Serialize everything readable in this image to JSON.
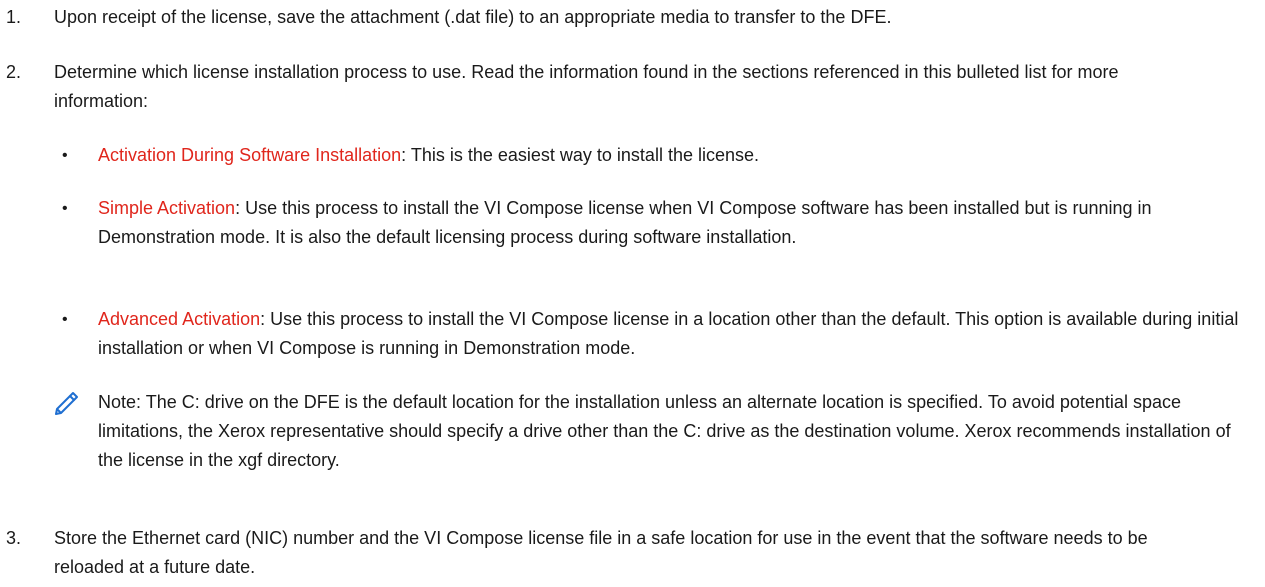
{
  "steps": [
    {
      "num": "1.",
      "text": "Upon receipt of the license, save the attachment (.dat file) to an appropriate media to transfer to the DFE."
    },
    {
      "num": "2.",
      "text": "Determine which license installation process to use. Read the information found in the sections referenced in this bulleted list for more information:"
    },
    {
      "num": "3.",
      "text": "Store the Ethernet card (NIC) number and the VI Compose license file in a safe location for use in the event that the software needs to be reloaded at a future date."
    }
  ],
  "bullets": [
    {
      "link": "Activation During Software Installation",
      "text": ": This is the easiest way to install the license."
    },
    {
      "link": "Simple Activation",
      "text": ": Use this process to install the VI Compose license when VI Compose software has been installed but is running in Demonstration mode. It is also the default licensing process during software installation."
    },
    {
      "link": "Advanced Activation",
      "text": ": Use this process to install the VI Compose license in a location other than the default. This option is available during initial installation or when VI Compose is running in Demonstration mode."
    }
  ],
  "note": {
    "icon": "pencil-icon",
    "text": "Note: The C: drive on the DFE is the default location for the installation unless an alternate location is specified. To avoid potential space limitations, the Xerox representative should specify a drive other than the C: drive as the destination volume. Xerox recommends installation of the license in the xgf directory."
  },
  "colors": {
    "link": "#e0261c",
    "icon": "#1f6fd1",
    "text": "#1a1a1a"
  }
}
